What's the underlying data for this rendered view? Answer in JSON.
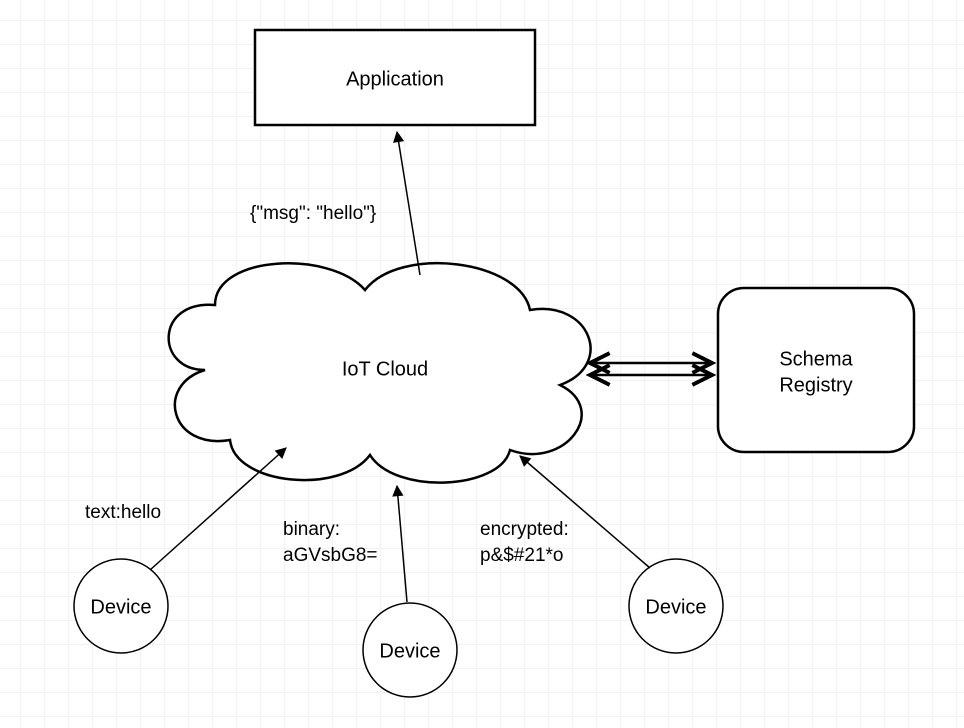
{
  "nodes": {
    "application": {
      "label": "Application"
    },
    "iot_cloud": {
      "label": "IoT Cloud"
    },
    "schema_registry": {
      "label_line1": "Schema",
      "label_line2": "Registry"
    },
    "device_left": {
      "label": "Device"
    },
    "device_middle": {
      "label": "Device"
    },
    "device_right": {
      "label": "Device"
    }
  },
  "edges": {
    "cloud_to_app": {
      "label": "{\"msg\": \"hello\"}"
    },
    "device_left_to_cloud": {
      "label": "text:hello"
    },
    "device_middle_to_cloud": {
      "label_line1": "binary:",
      "label_line2": "aGVsbG8="
    },
    "device_right_to_cloud": {
      "label_line1": "encrypted:",
      "label_line2": "p&$#21*o"
    }
  }
}
